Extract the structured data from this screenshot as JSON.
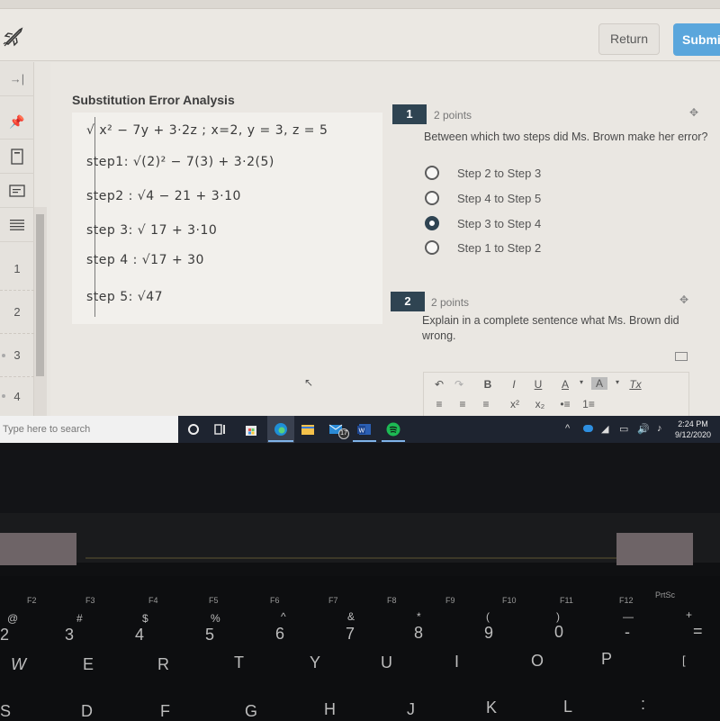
{
  "header": {
    "return_label": "Return",
    "submit_label": "Submit",
    "accent_color": "#5aa6dc"
  },
  "sidebar": {
    "icons": [
      "collapse-icon",
      "pin-icon",
      "page-icon",
      "card-icon",
      "lines-icon"
    ],
    "items": [
      {
        "label": "1"
      },
      {
        "label": "2"
      },
      {
        "label": "3"
      },
      {
        "label": "4"
      }
    ]
  },
  "assignment": {
    "title": "Substitution Error Analysis",
    "handwriting": [
      "√ x² − 7y + 3·2z  ;  x=2, y = 3, z = 5",
      "step1: √(2)² − 7(3) + 3·2(5)",
      "step2 : √4 − 21 + 3·10",
      "step 3: √ 17 + 3·10",
      "step 4 : √17 + 30",
      "step 5: √47"
    ]
  },
  "questions": [
    {
      "number": "1",
      "points": "2 points",
      "text": "Between which two steps did Ms. Brown make her error?",
      "choices": [
        {
          "label": "Step 2 to Step 3",
          "selected": false
        },
        {
          "label": "Step 4 to Step 5",
          "selected": false
        },
        {
          "label": "Step 3 to Step 4",
          "selected": true
        },
        {
          "label": "Step 1 to Step 2",
          "selected": false
        }
      ]
    },
    {
      "number": "2",
      "points": "2 points",
      "text": "Explain in a complete sentence what Ms. Brown did wrong."
    }
  ],
  "editor_toolbar": {
    "row1": [
      "↶",
      "↷",
      "B",
      "I",
      "U",
      "A",
      "▾",
      "A",
      "▾",
      "Tx"
    ],
    "row2": [
      "≡",
      "≡",
      "≡",
      "x²",
      "x₂",
      "•≡",
      "1≡"
    ]
  },
  "taskbar": {
    "search_placeholder": "Type here to search",
    "mail_badge": "17",
    "time": "2:24 PM",
    "date": "9/12/2020"
  },
  "keyboard": {
    "fn_row": [
      "F2",
      "F3",
      "F4",
      "F5",
      "F6",
      "F7",
      "F8",
      "F9",
      "F10",
      "F11",
      "F12",
      "PrtSc"
    ],
    "num_row": [
      "2",
      "3",
      "4",
      "5",
      "6",
      "7",
      "8",
      "9",
      "0",
      "-",
      "="
    ],
    "num_row_shift": [
      "@",
      "#",
      "$",
      "%",
      "^",
      "&",
      "*",
      "(",
      ")",
      "—",
      "+"
    ],
    "qwerty_row": [
      "W",
      "E",
      "R",
      "T",
      "Y",
      "U",
      "I",
      "O",
      "P",
      "["
    ],
    "asdf_row": [
      "S",
      "D",
      "F",
      "G",
      "H",
      "J",
      "K",
      "L",
      ":"
    ]
  }
}
